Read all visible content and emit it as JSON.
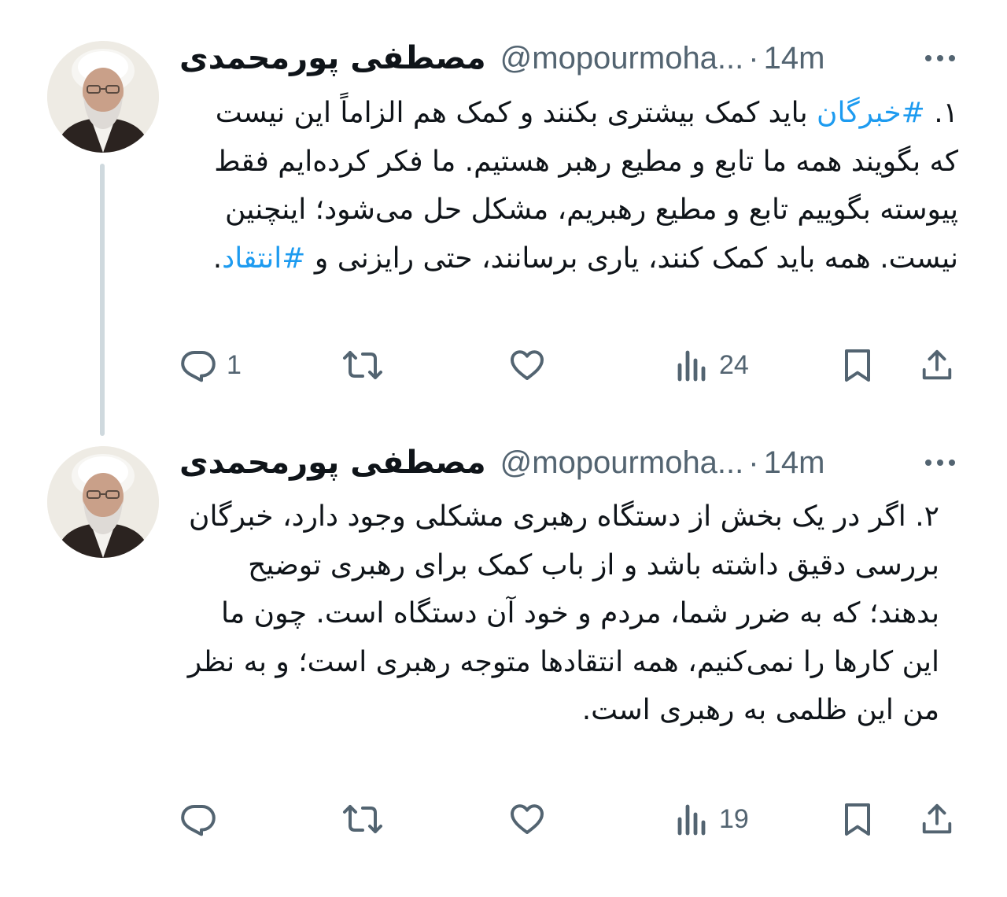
{
  "tweets": [
    {
      "author_name": "مصطفی پورمحمدی",
      "handle": "@mopourmoha...",
      "separator": "·",
      "time": "14m",
      "number": "۱.",
      "hashtag_1": "#خبرگان",
      "text_1": "باید کمک بیشتری بکنند و کمک هم الزاماً این نیست که بگویند همه ما تابع و مطیع رهبر هستیم. ما فکر کرده‌ایم فقط پیوسته بگوییم تابع و مطیع رهبریم، مشکل حل می‌شود؛ اینچنین نیست. همه باید کمک کنند، یاری برسانند، حتی رایزنی و",
      "hashtag_2": "#انتقاد",
      "text_end": ".",
      "replies": "1",
      "reposts": "",
      "likes": "",
      "views": "24"
    },
    {
      "author_name": "مصطفی پورمحمدی",
      "handle": "@mopourmoha...",
      "separator": "·",
      "time": "14m",
      "text": "۲. اگر در یک بخش از دستگاه رهبری مشکلی وجود دارد، خبرگان بررسی دقیق داشته باشد و از باب کمک برای رهبری توضیح بدهند؛ که به ضرر شما، مردم و خود آن دستگاه است. چون ما این کارها را نمی‌کنیم، همه انتقادها متوجه رهبری است؛ و به نظر من این ظلمی به رهبری است.",
      "replies": "",
      "reposts": "",
      "likes": "",
      "views": "19"
    }
  ],
  "icons": [
    "more-icon",
    "reply-icon",
    "repost-icon",
    "like-icon",
    "views-icon",
    "bookmark-icon",
    "share-icon"
  ],
  "colors": {
    "hashtag": "#1d9bf0",
    "muted": "#536471",
    "thread_line": "#cfd9de",
    "text": "#0f1419"
  }
}
